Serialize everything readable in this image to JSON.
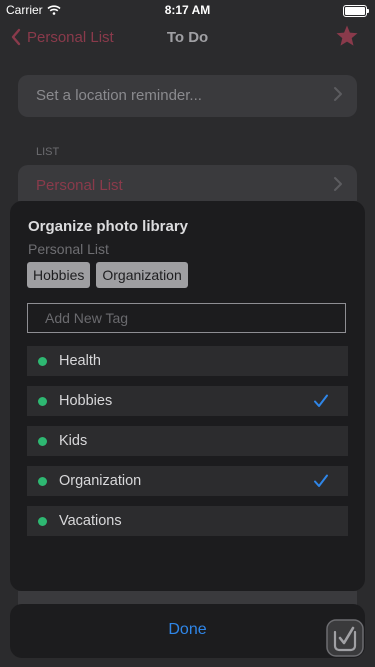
{
  "status_bar": {
    "carrier": "Carrier",
    "time": "8:17 AM"
  },
  "nav": {
    "back_label": "Personal List",
    "title": "To Do",
    "star_icon": "star-icon"
  },
  "background": {
    "location_reminder": "Set a location reminder...",
    "section_list": "LIST",
    "list_name": "Personal List"
  },
  "sheet": {
    "title": "Organize photo library",
    "subtitle": "Personal List",
    "selected_tags": [
      "Hobbies",
      "Organization"
    ],
    "add_tag_placeholder": "Add New Tag",
    "tags": [
      {
        "label": "Health",
        "checked": false
      },
      {
        "label": "Hobbies",
        "checked": true
      },
      {
        "label": "Kids",
        "checked": false
      },
      {
        "label": "Organization",
        "checked": true
      },
      {
        "label": "Vacations",
        "checked": false
      }
    ]
  },
  "done_label": "Done",
  "colors": {
    "accent_red": "#8a3a4b",
    "check_blue": "#2f86e8",
    "tag_dot_green": "#2eb872"
  }
}
